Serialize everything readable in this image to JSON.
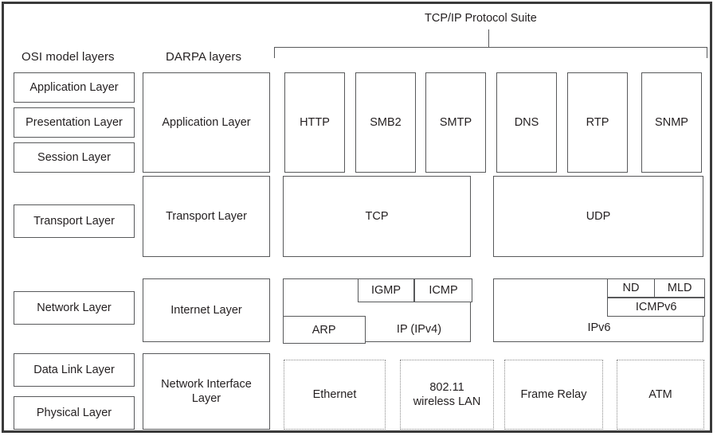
{
  "figure": {
    "suite_label": "TCP/IP Protocol Suite",
    "headers": {
      "osi": "OSI model layers",
      "darpa": "DARPA layers"
    }
  },
  "osi_layers": [
    {
      "label": "Application Layer"
    },
    {
      "label": "Presentation Layer"
    },
    {
      "label": "Session Layer"
    },
    {
      "label": "Transport Layer"
    },
    {
      "label": "Network Layer"
    },
    {
      "label": "Data Link Layer"
    },
    {
      "label": "Physical Layer"
    }
  ],
  "darpa_layers": [
    {
      "label": "Application Layer"
    },
    {
      "label": "Transport Layer"
    },
    {
      "label": "Internet Layer"
    },
    {
      "label": "Network Interface Layer"
    }
  ],
  "application_protocols": [
    {
      "label": "HTTP"
    },
    {
      "label": "SMB2"
    },
    {
      "label": "SMTP"
    },
    {
      "label": "DNS"
    },
    {
      "label": "RTP"
    },
    {
      "label": "SNMP"
    }
  ],
  "transport_protocols": [
    {
      "label": "TCP"
    },
    {
      "label": "UDP"
    }
  ],
  "internet_ipv4": {
    "igmp": "IGMP",
    "icmp": "ICMP",
    "arp": "ARP",
    "ip": "IP (IPv4)"
  },
  "internet_ipv6": {
    "nd": "ND",
    "mld": "MLD",
    "icmpv6": "ICMPv6",
    "ipv6": "IPv6"
  },
  "network_interface_technologies": [
    {
      "label": "Ethernet"
    },
    {
      "label": "802.11 wireless LAN"
    },
    {
      "label": "Frame Relay"
    },
    {
      "label": "ATM"
    }
  ],
  "colors": {
    "frame_border": "#3a3a3a",
    "box_border": "#58595b",
    "dotted_border": "#8a8a8a",
    "text": "#231f20",
    "background": "#ffffff"
  }
}
